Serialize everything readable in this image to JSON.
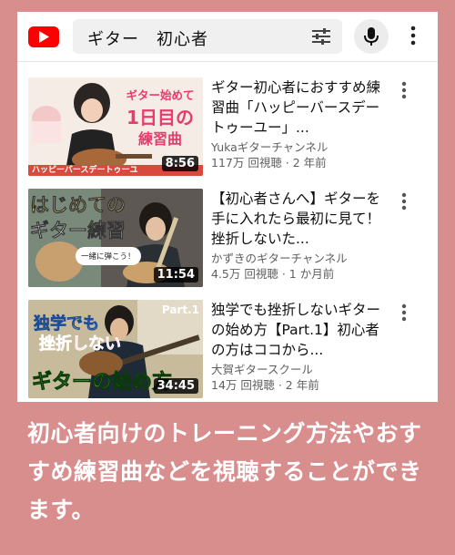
{
  "search": {
    "query": "ギター　初心者"
  },
  "icons": {
    "logo": "youtube-logo",
    "filter": "sliders-icon",
    "mic": "microphone-icon",
    "menu": "more-vert-icon"
  },
  "videos": [
    {
      "title": "ギター初心者におすすめ練習曲「ハッピーバースデートゥーユー」...",
      "channel": "Yukaギターチャンネル",
      "meta": "117万 回視聴 · 2 年前",
      "duration": "8:56",
      "thumb_text": [
        "ギター始めて",
        "1日目の",
        "練習曲",
        "ハッピーバースデートゥーユ"
      ]
    },
    {
      "title": "【初心者さんへ】ギターを手に入れたら最初に見て！挫折しないた...",
      "channel": "かずきのギターチャンネル",
      "meta": "4.5万 回視聴 · 1 か月前",
      "duration": "11:54",
      "thumb_text": [
        "はじめての",
        "ギター練習",
        "一緒に弾こう！"
      ]
    },
    {
      "title": "独学でも挫折しないギターの始め方【Part.1】初心者の方はココから...",
      "channel": "大賀ギタースクール",
      "meta": "14万 回視聴 · 2 年前",
      "duration": "34:45",
      "thumb_text": [
        "独学でも",
        "挫折しない",
        "ギターの始め方",
        "Part.1"
      ]
    }
  ],
  "caption": "初心者向けのトレーニング方法やおすすめ練習曲などを視聴することができます。",
  "colors": {
    "background": "#d98e8e",
    "brand": "#ff0000"
  }
}
